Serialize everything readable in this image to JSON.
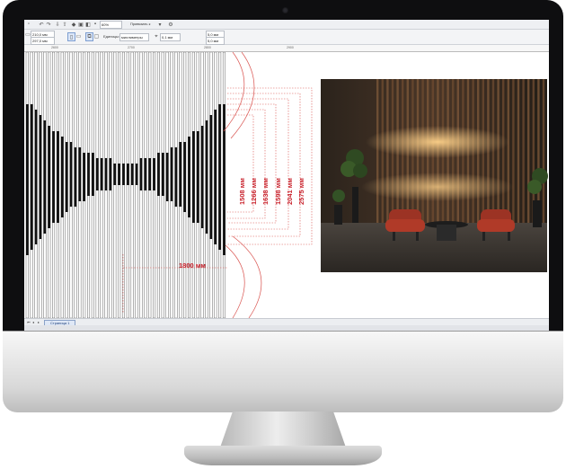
{
  "app": {
    "zoom": "60%",
    "snap_label": "Привязать к",
    "units_label": "Единицы:",
    "units_value": "миллиметры",
    "field_x": "210,0 мм",
    "field_y": "297,0 мм",
    "nudge": "0,1 мм",
    "dup_x": "5,0 мм",
    "dup_y": "5,0 мм"
  },
  "ruler": {
    "ticks": [
      "2600",
      "2700",
      "2800",
      "2900"
    ]
  },
  "drawing": {
    "width_label": "1800 мм",
    "height_labels": [
      "1508 мм",
      "1266 мм",
      "1638 мм",
      "1598 мм",
      "2041 мм",
      "2575 мм"
    ]
  },
  "status": {
    "page_tab": "Страница 1"
  },
  "colors": {
    "dimension": "#c8212b",
    "bezel": "#0e0e10"
  }
}
